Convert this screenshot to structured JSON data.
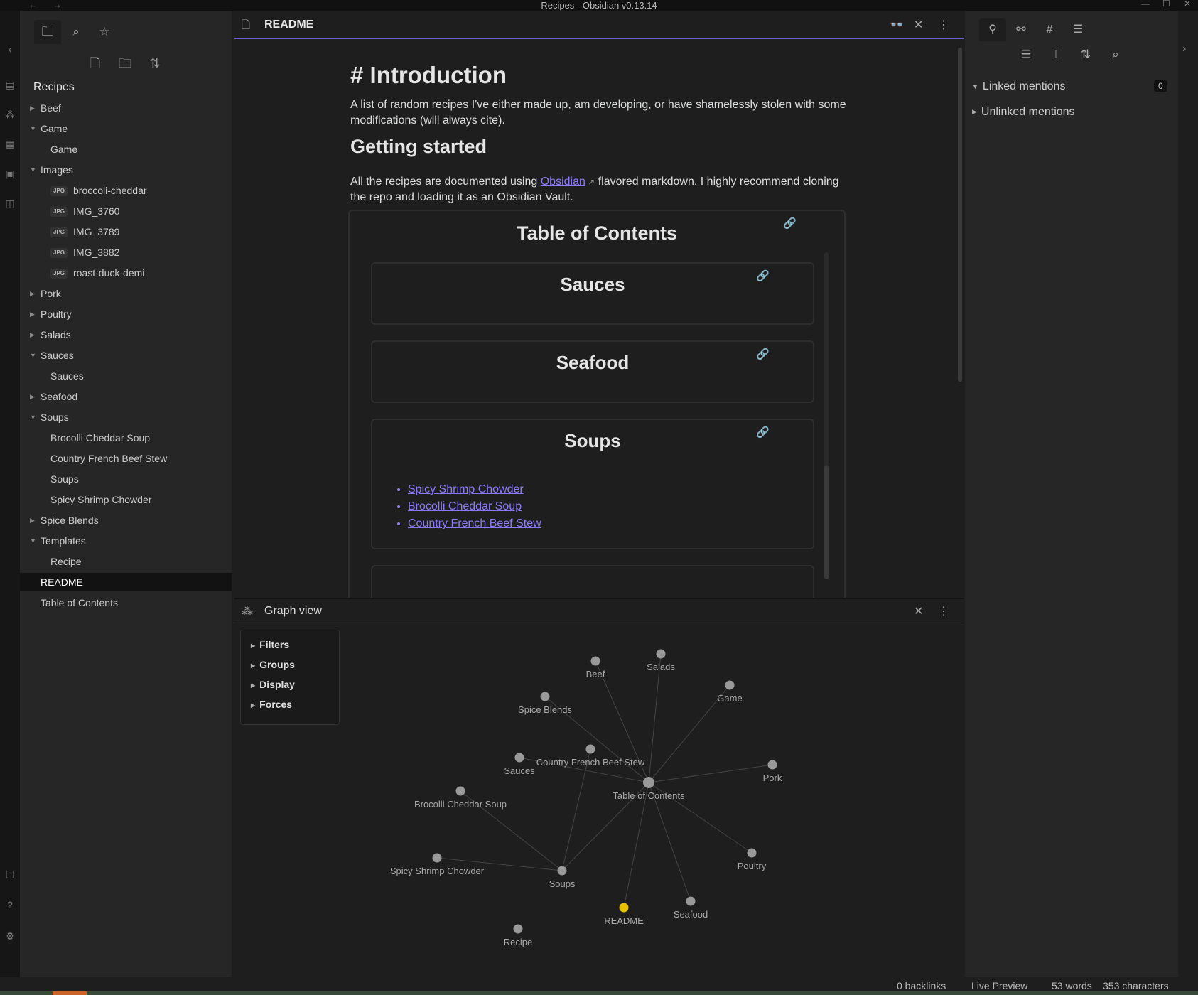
{
  "window": {
    "title": "Recipes - Obsidian v0.13.14",
    "nav_back": "←",
    "nav_forward": "→",
    "minimize": "—",
    "maximize": "☐",
    "close": "✕"
  },
  "left_panel": {
    "vault_name": "Recipes",
    "tabs": [
      "file-explorer",
      "search",
      "starred"
    ],
    "actions": [
      "new-note",
      "new-folder",
      "sort"
    ],
    "tree": [
      {
        "label": "Beef",
        "type": "folder",
        "expanded": false,
        "depth": 0
      },
      {
        "label": "Game",
        "type": "folder",
        "expanded": true,
        "depth": 0
      },
      {
        "label": "Game",
        "type": "file",
        "depth": 1
      },
      {
        "label": "Images",
        "type": "folder",
        "expanded": true,
        "depth": 0
      },
      {
        "label": "broccoli-cheddar",
        "type": "jpg",
        "depth": 1
      },
      {
        "label": "IMG_3760",
        "type": "jpg",
        "depth": 1
      },
      {
        "label": "IMG_3789",
        "type": "jpg",
        "depth": 1
      },
      {
        "label": "IMG_3882",
        "type": "jpg",
        "depth": 1
      },
      {
        "label": "roast-duck-demi",
        "type": "jpg",
        "depth": 1
      },
      {
        "label": "Pork",
        "type": "folder",
        "expanded": false,
        "depth": 0
      },
      {
        "label": "Poultry",
        "type": "folder",
        "expanded": false,
        "depth": 0
      },
      {
        "label": "Salads",
        "type": "folder",
        "expanded": false,
        "depth": 0
      },
      {
        "label": "Sauces",
        "type": "folder",
        "expanded": true,
        "depth": 0
      },
      {
        "label": "Sauces",
        "type": "file",
        "depth": 1
      },
      {
        "label": "Seafood",
        "type": "folder",
        "expanded": false,
        "depth": 0
      },
      {
        "label": "Soups",
        "type": "folder",
        "expanded": true,
        "depth": 0
      },
      {
        "label": "Brocolli Cheddar Soup",
        "type": "file",
        "depth": 1
      },
      {
        "label": "Country French Beef Stew",
        "type": "file",
        "depth": 1
      },
      {
        "label": "Soups",
        "type": "file",
        "depth": 1
      },
      {
        "label": "Spicy Shrimp Chowder",
        "type": "file",
        "depth": 1
      },
      {
        "label": "Spice Blends",
        "type": "folder",
        "expanded": false,
        "depth": 0
      },
      {
        "label": "Templates",
        "type": "folder",
        "expanded": true,
        "depth": 0
      },
      {
        "label": "Recipe",
        "type": "file",
        "depth": 1
      },
      {
        "label": "README",
        "type": "file",
        "depth": 0,
        "selected": true
      },
      {
        "label": "Table of Contents",
        "type": "file",
        "depth": 0
      }
    ],
    "jpg_badge": "JPG"
  },
  "editor": {
    "tab_title": "README",
    "h1": "# Introduction",
    "intro": "A list of random recipes I've either made up, am developing, or have shamelessly stolen with some modifications (will always cite).",
    "h2": "Getting started",
    "gs_before": "All the recipes are documented using ",
    "gs_link": "Obsidian",
    "gs_after": " flavored markdown. I highly recommend cloning the repo and loading it as an Obsidian Vault.",
    "toc_title": "Table of Contents",
    "toc_sections": [
      "Sauces",
      "Seafood",
      "Soups"
    ],
    "soups_links": [
      "Spicy Shrimp Chowder",
      "Brocolli Cheddar Soup",
      "Country French Beef Stew"
    ]
  },
  "graph": {
    "title": "Graph view",
    "controls": [
      "Filters",
      "Groups",
      "Display",
      "Forces"
    ],
    "nodes": [
      {
        "label": "Beef"
      },
      {
        "label": "Salads"
      },
      {
        "label": "Game"
      },
      {
        "label": "Spice Blends"
      },
      {
        "label": "Country French Beef Stew"
      },
      {
        "label": "Sauces"
      },
      {
        "label": "Pork"
      },
      {
        "label": "Table of Contents"
      },
      {
        "label": "Brocolli Cheddar Soup"
      },
      {
        "label": "Poultry"
      },
      {
        "label": "Spicy Shrimp Chowder"
      },
      {
        "label": "Soups"
      },
      {
        "label": "README",
        "active": true
      },
      {
        "label": "Seafood"
      },
      {
        "label": "Recipe"
      }
    ],
    "edges": [
      [
        "Table of Contents",
        "Beef"
      ],
      [
        "Table of Contents",
        "Salads"
      ],
      [
        "Table of Contents",
        "Game"
      ],
      [
        "Table of Contents",
        "Spice Blends"
      ],
      [
        "Table of Contents",
        "Sauces"
      ],
      [
        "Table of Contents",
        "Pork"
      ],
      [
        "Table of Contents",
        "Poultry"
      ],
      [
        "Table of Contents",
        "Seafood"
      ],
      [
        "Table of Contents",
        "Soups"
      ],
      [
        "Table of Contents",
        "README"
      ],
      [
        "Soups",
        "Spicy Shrimp Chowder"
      ],
      [
        "Soups",
        "Brocolli Cheddar Soup"
      ],
      [
        "Soups",
        "Country French Beef Stew"
      ]
    ]
  },
  "right_panel": {
    "tabs": [
      "backlinks",
      "outgoing-links",
      "tags",
      "outline"
    ],
    "actions": [
      "collapse-results",
      "show-more-context",
      "sort",
      "search"
    ],
    "linked_mentions": "Linked mentions",
    "linked_count": "0",
    "unlinked_mentions": "Unlinked mentions"
  },
  "status_bar": {
    "backlinks": "0 backlinks",
    "mode": "Live Preview",
    "words": "53 words",
    "characters": "353 characters"
  },
  "colors": {
    "accent": "#6b5fd3",
    "link": "#8b7cf6",
    "active_node": "#e6c200"
  }
}
